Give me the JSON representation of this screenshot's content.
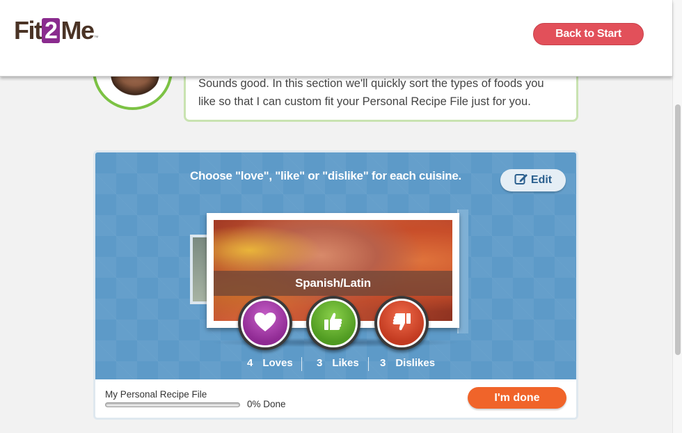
{
  "header": {
    "logo": {
      "pre": "Fit",
      "mid": "2",
      "post": "Me",
      "tm": "™"
    },
    "back_button": "Back to Start"
  },
  "coach": {
    "message_line1": "Sounds good. In this section we'll quickly sort the types of foods you",
    "message_line2": "like so that I can custom fit your Personal Recipe File just for you."
  },
  "sorter": {
    "instruction": "Choose \"love\", \"like\" or \"dislike\" for each cuisine.",
    "edit_button": "Edit",
    "current_cuisine": "Spanish/Latin",
    "counts": {
      "loves_num": "4",
      "loves_label": "Loves",
      "likes_num": "3",
      "likes_label": "Likes",
      "dislikes_num": "3",
      "dislikes_label": "Dislikes"
    }
  },
  "footer": {
    "file_label": "My Personal Recipe File",
    "progress_text": "0% Done",
    "progress_percent": 0,
    "done_button": "I'm done"
  },
  "colors": {
    "brand_purple": "#8a2b8e",
    "back_button": "#e2505a",
    "panel_blue": "#5d9ac8",
    "done_orange": "#f0642a",
    "love": "#a23aa6",
    "like": "#5aab2b",
    "dislike": "#d64a2c"
  },
  "icons": {
    "edit": "edit-pencil-icon",
    "love": "heart-icon",
    "like": "thumbs-up-icon",
    "dislike": "thumbs-down-icon"
  }
}
